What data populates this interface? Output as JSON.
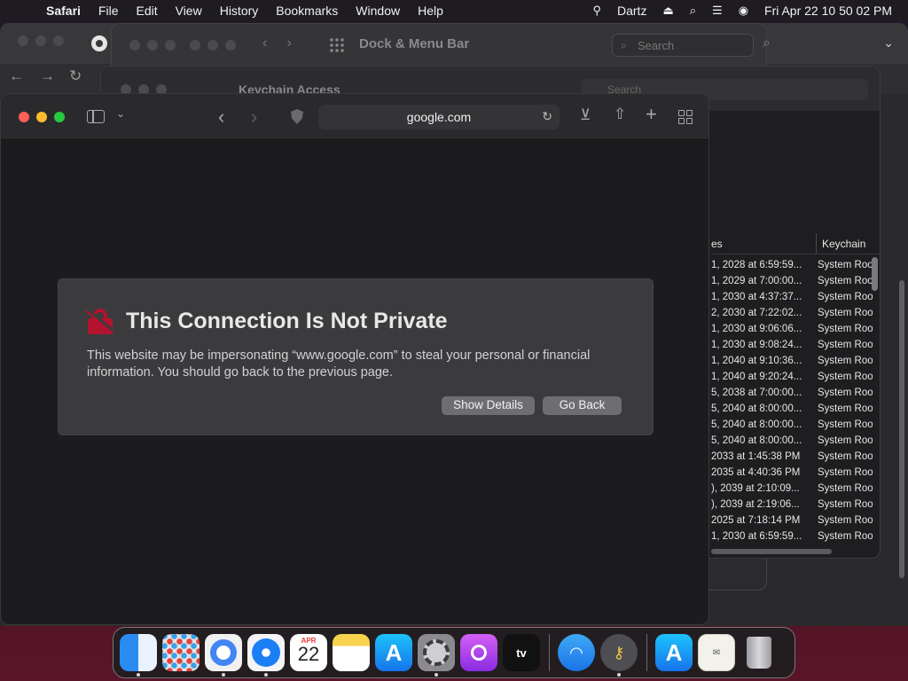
{
  "menubar": {
    "apple": "",
    "app_name": "Safari",
    "items": [
      "File",
      "Edit",
      "View",
      "History",
      "Bookmarks",
      "Window",
      "Help"
    ],
    "user": "Dartz",
    "clock": "Fri Apr 22  10 50 02 PM"
  },
  "prefs_window": {
    "title": "Dock & Menu Bar",
    "search_placeholder": "Search"
  },
  "keychain_window": {
    "title": "Keychain Access",
    "search_placeholder": "Search",
    "columns": [
      "es",
      "Keychain"
    ],
    "rows": [
      {
        "date": "1, 2028 at 6:59:59...",
        "keychain": "System Roots"
      },
      {
        "date": "1, 2029 at 7:00:00...",
        "keychain": "System Roots"
      },
      {
        "date": "1, 2030 at 4:37:37...",
        "keychain": "System Roots"
      },
      {
        "date": "2, 2030 at 7:22:02...",
        "keychain": "System Roots"
      },
      {
        "date": "1, 2030 at 9:06:06...",
        "keychain": "System Roots"
      },
      {
        "date": "1, 2030 at 9:08:24...",
        "keychain": "System Roots"
      },
      {
        "date": "1, 2040 at 9:10:36...",
        "keychain": "System Roots"
      },
      {
        "date": "1, 2040 at 9:20:24...",
        "keychain": "System Roots"
      },
      {
        "date": "5, 2038 at 7:00:00...",
        "keychain": "System Roots"
      },
      {
        "date": "5, 2040 at 8:00:00...",
        "keychain": "System Roots"
      },
      {
        "date": "5, 2040 at 8:00:00...",
        "keychain": "System Roots"
      },
      {
        "date": "5, 2040 at 8:00:00...",
        "keychain": "System Roots"
      },
      {
        "date": " 2033 at 1:45:38 PM",
        "keychain": "System Roots"
      },
      {
        "date": " 2035 at 4:40:36 PM",
        "keychain": "System Roots"
      },
      {
        "date": "), 2039 at 2:10:09...",
        "keychain": "System Roots"
      },
      {
        "date": "), 2039 at 2:19:06...",
        "keychain": "System Roots"
      },
      {
        "date": " 2025 at 7:18:14 PM",
        "keychain": "System Roots"
      },
      {
        "date": "1, 2030 at 6:59:59...",
        "keychain": "System Roots"
      }
    ]
  },
  "safari": {
    "url": "google.com",
    "warning": {
      "title": "This Connection Is Not Private",
      "body": "This website may be impersonating “www.google.com” to steal your personal or financial information. You should go back to the previous page.",
      "show_details": "Show Details",
      "go_back": "Go Back"
    },
    "colors": {
      "warning_lock": "#b3132f",
      "panel": "#3b3b3d"
    }
  },
  "dock": {
    "calendar_month": "APR",
    "calendar_day": "22",
    "tv_label": "tv",
    "items": [
      "Finder",
      "Launchpad",
      "Google Chrome",
      "Safari",
      "Calendar",
      "Notes",
      "App Store",
      "System Preferences",
      "Podcasts",
      "TV",
      "Wireless Diagnostics",
      "Keychain Access",
      "App Store",
      "Certificate",
      "Trash"
    ]
  }
}
